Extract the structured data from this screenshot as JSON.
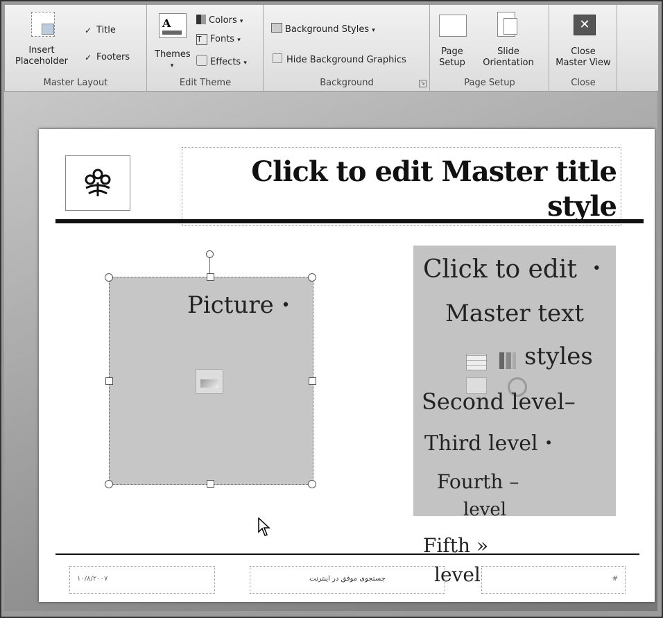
{
  "ribbon": {
    "master_layout": {
      "insert_placeholder": "Insert\nPlaceholder",
      "title_check": "Title",
      "footers_check": "Footers",
      "group_label": "Master Layout"
    },
    "edit_theme": {
      "themes": "Themes",
      "colors": "Colors",
      "fonts": "Fonts",
      "effects": "Effects",
      "group_label": "Edit Theme"
    },
    "background": {
      "background_styles": "Background Styles",
      "hide_background_graphics": "Hide Background Graphics",
      "group_label": "Background"
    },
    "page_setup": {
      "page_setup": "Page\nSetup",
      "slide_orientation": "Slide\nOrientation",
      "group_label": "Page Setup"
    },
    "close": {
      "close_master_view": "Close\nMaster View",
      "group_label": "Close"
    }
  },
  "slide": {
    "title_line1": "Click to edit Master title",
    "title_line2": "style",
    "picture_label": "Picture",
    "text_levels": {
      "level1_a": "Click to edit",
      "level1_b": "Master text",
      "level1_c": "styles",
      "level2": "Second level",
      "level3": "Third level",
      "level4_a": "Fourth",
      "level4_b": "level",
      "level5_a": "Fifth",
      "level5_b": "level"
    },
    "footer": {
      "date": "۱۰/۸/۲۰۰۷",
      "center": "جستجوی موفق در اینترنت",
      "number": "#"
    }
  }
}
